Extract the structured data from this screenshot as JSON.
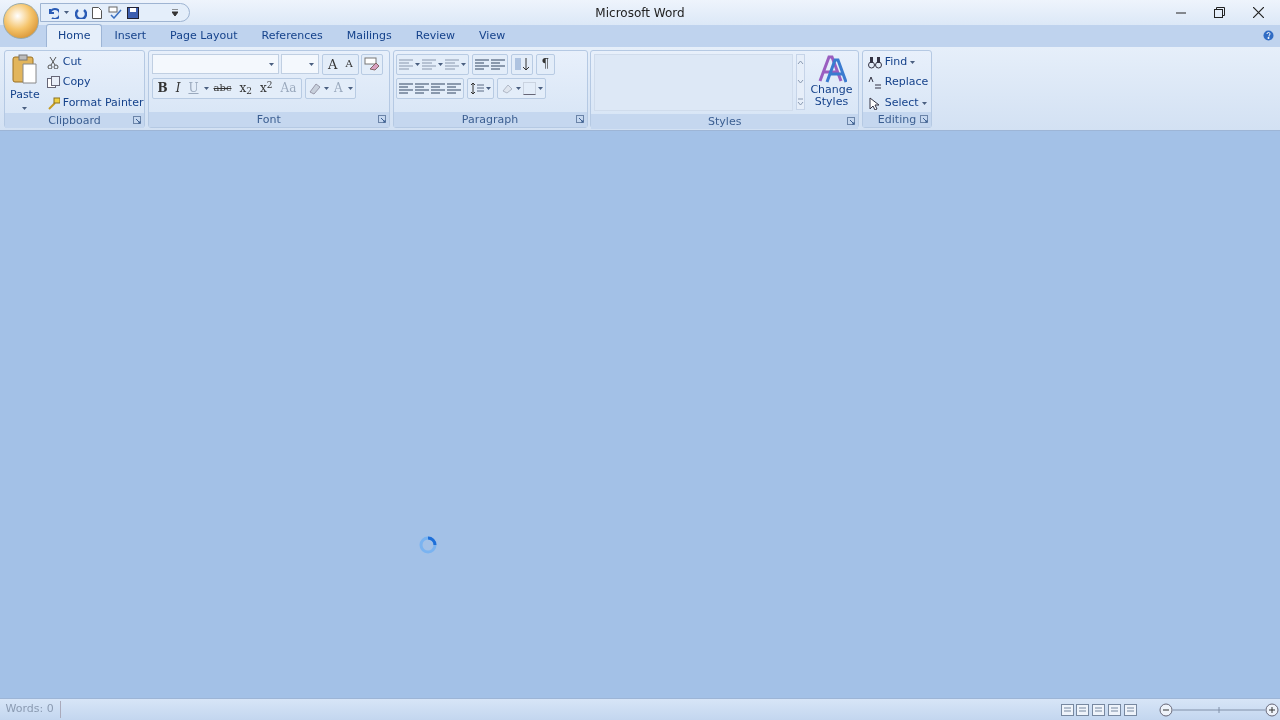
{
  "window": {
    "title": "Microsoft Word"
  },
  "tabs": [
    {
      "label": "Home",
      "selected": true
    },
    {
      "label": "Insert",
      "selected": false
    },
    {
      "label": "Page Layout",
      "selected": false
    },
    {
      "label": "References",
      "selected": false
    },
    {
      "label": "Mailings",
      "selected": false
    },
    {
      "label": "Review",
      "selected": false
    },
    {
      "label": "View",
      "selected": false
    }
  ],
  "ribbon": {
    "clipboard": {
      "label": "Clipboard",
      "paste": "Paste",
      "items": [
        {
          "kind": "cut",
          "label": "Cut"
        },
        {
          "kind": "copy",
          "label": "Copy"
        },
        {
          "kind": "painter",
          "label": "Format Painter"
        }
      ]
    },
    "font": {
      "label": "Font",
      "size_buttons": [
        "A",
        "A"
      ],
      "format_buttons": [
        "B",
        "I",
        "U",
        "abc",
        "x$_{2}$",
        "x$^{2}$",
        "Aa"
      ],
      "color_button": "A"
    },
    "paragraph": {
      "label": "Paragraph",
      "pilcrow": "¶"
    },
    "styles": {
      "label": "Styles",
      "change_styles": "Change Styles"
    },
    "editing": {
      "label": "Editing",
      "items": [
        {
          "kind": "find",
          "label": "Find"
        },
        {
          "kind": "replace",
          "label": "Replace"
        },
        {
          "kind": "select",
          "label": "Select"
        }
      ]
    }
  },
  "status_bar": {
    "words": "Words: 0"
  }
}
